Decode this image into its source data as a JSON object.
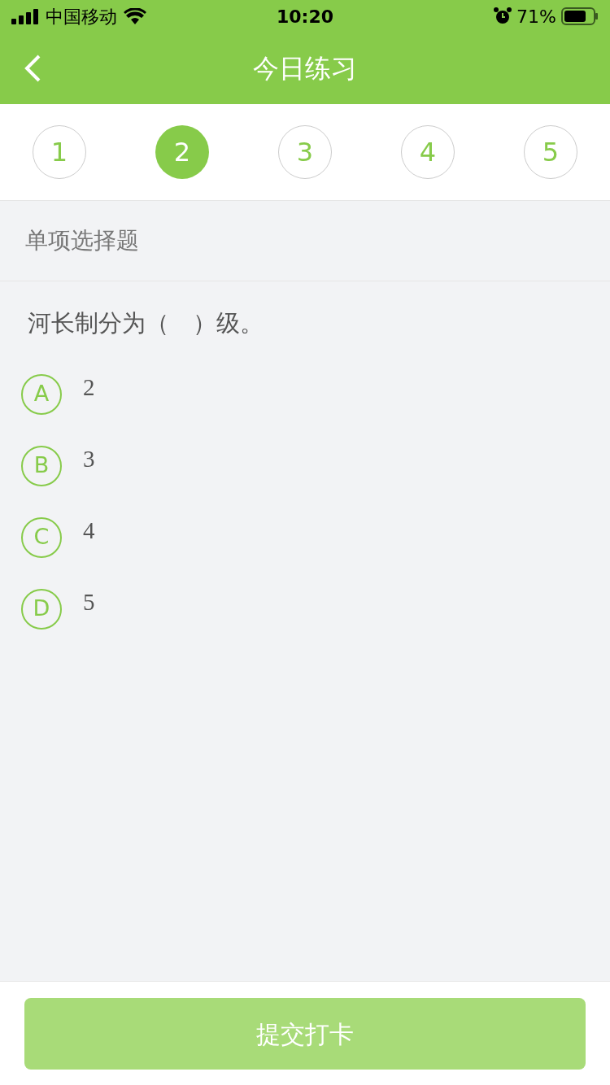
{
  "status_bar": {
    "carrier": "中国移动",
    "time": "10:20",
    "battery": "71%"
  },
  "nav": {
    "title": "今日练习"
  },
  "steps": [
    {
      "label": "1",
      "selected": false
    },
    {
      "label": "2",
      "selected": true
    },
    {
      "label": "3",
      "selected": false
    },
    {
      "label": "4",
      "selected": false
    },
    {
      "label": "5",
      "selected": false
    }
  ],
  "section": "单项选择题",
  "question": "河长制分为（　）级。",
  "options": [
    {
      "letter": "A",
      "text": "2",
      "selected": false
    },
    {
      "letter": "B",
      "text": "3",
      "selected": false
    },
    {
      "letter": "C",
      "text": "4",
      "selected": false
    },
    {
      "letter": "D",
      "text": "5",
      "selected": false
    }
  ],
  "submit": {
    "label": "提交打卡",
    "disabled": true
  }
}
